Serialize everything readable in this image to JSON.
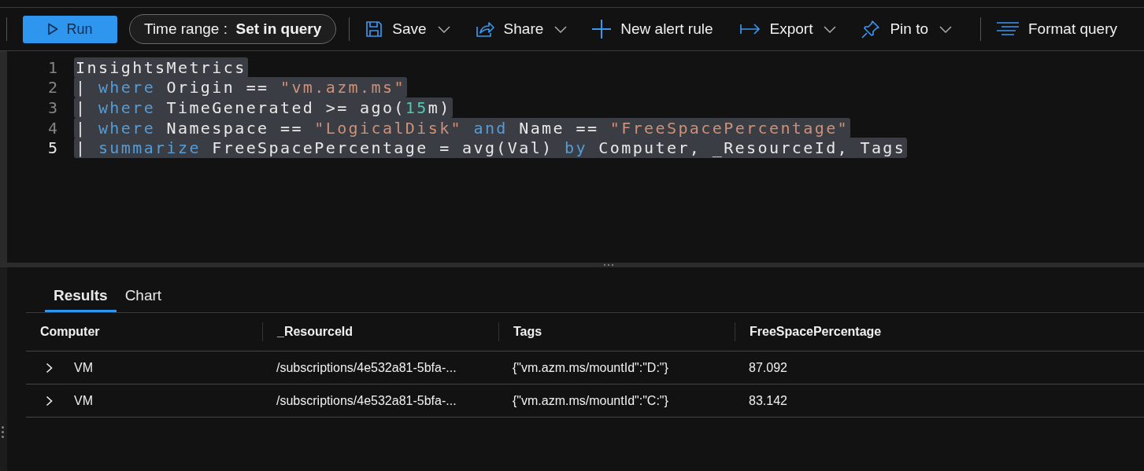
{
  "toolbar": {
    "run_label": "Run",
    "time_range": {
      "label": "Time range :",
      "value": "Set in query"
    },
    "actions": [
      {
        "kind": "save",
        "label": "Save",
        "dropdown": true
      },
      {
        "kind": "share",
        "label": "Share",
        "dropdown": true
      },
      {
        "kind": "alert",
        "label": "New alert rule",
        "dropdown": false
      },
      {
        "kind": "export",
        "label": "Export",
        "dropdown": true
      },
      {
        "kind": "pin",
        "label": "Pin to",
        "dropdown": true
      },
      {
        "kind": "format",
        "label": "Format query",
        "dropdown": false
      }
    ]
  },
  "editor": {
    "lines": [
      {
        "number": "1",
        "active": false,
        "selected": true,
        "tokens": [
          {
            "kind": "plain",
            "text": "InsightsMetrics"
          }
        ]
      },
      {
        "number": "2",
        "active": false,
        "selected": true,
        "tokens": [
          {
            "kind": "plain",
            "text": "| "
          },
          {
            "kind": "keyword",
            "text": "where"
          },
          {
            "kind": "plain",
            "text": " Origin == "
          },
          {
            "kind": "string",
            "text": "\"vm.azm.ms\""
          }
        ]
      },
      {
        "number": "3",
        "active": false,
        "selected": true,
        "tokens": [
          {
            "kind": "plain",
            "text": "| "
          },
          {
            "kind": "keyword",
            "text": "where"
          },
          {
            "kind": "plain",
            "text": " TimeGenerated >= ago("
          },
          {
            "kind": "number",
            "text": "15"
          },
          {
            "kind": "plain",
            "text": "m)"
          }
        ]
      },
      {
        "number": "4",
        "active": false,
        "selected": true,
        "tokens": [
          {
            "kind": "plain",
            "text": "| "
          },
          {
            "kind": "keyword",
            "text": "where"
          },
          {
            "kind": "plain",
            "text": " Namespace == "
          },
          {
            "kind": "string",
            "text": "\"LogicalDisk\""
          },
          {
            "kind": "keyword",
            "text": " and"
          },
          {
            "kind": "plain",
            "text": " Name == "
          },
          {
            "kind": "string",
            "text": "\"FreeSpacePercentage\""
          }
        ]
      },
      {
        "number": "5",
        "active": true,
        "selected": true,
        "tokens": [
          {
            "kind": "plain",
            "text": "| "
          },
          {
            "kind": "keyword",
            "text": "summarize"
          },
          {
            "kind": "plain",
            "text": " FreeSpacePercentage = avg(Val) "
          },
          {
            "kind": "keyword",
            "text": "by"
          },
          {
            "kind": "plain",
            "text": " Computer, _ResourceId, Tags"
          }
        ]
      }
    ]
  },
  "results": {
    "tabs": [
      {
        "label": "Results",
        "selected": true
      },
      {
        "label": "Chart",
        "selected": false
      }
    ],
    "table": {
      "columns": [
        "Computer",
        "_ResourceId",
        "Tags",
        "FreeSpacePercentage"
      ],
      "rows": [
        {
          "expanded": false,
          "cells": [
            "VM",
            "/subscriptions/4e532a81-5bfa-...",
            "{\"vm.azm.ms/mountId\":\"D:\"}",
            "87.092"
          ]
        },
        {
          "expanded": false,
          "cells": [
            "VM",
            "/subscriptions/4e532a81-5bfa-...",
            "{\"vm.azm.ms/mountId\":\"C:\"}",
            "83.142"
          ]
        }
      ]
    }
  }
}
